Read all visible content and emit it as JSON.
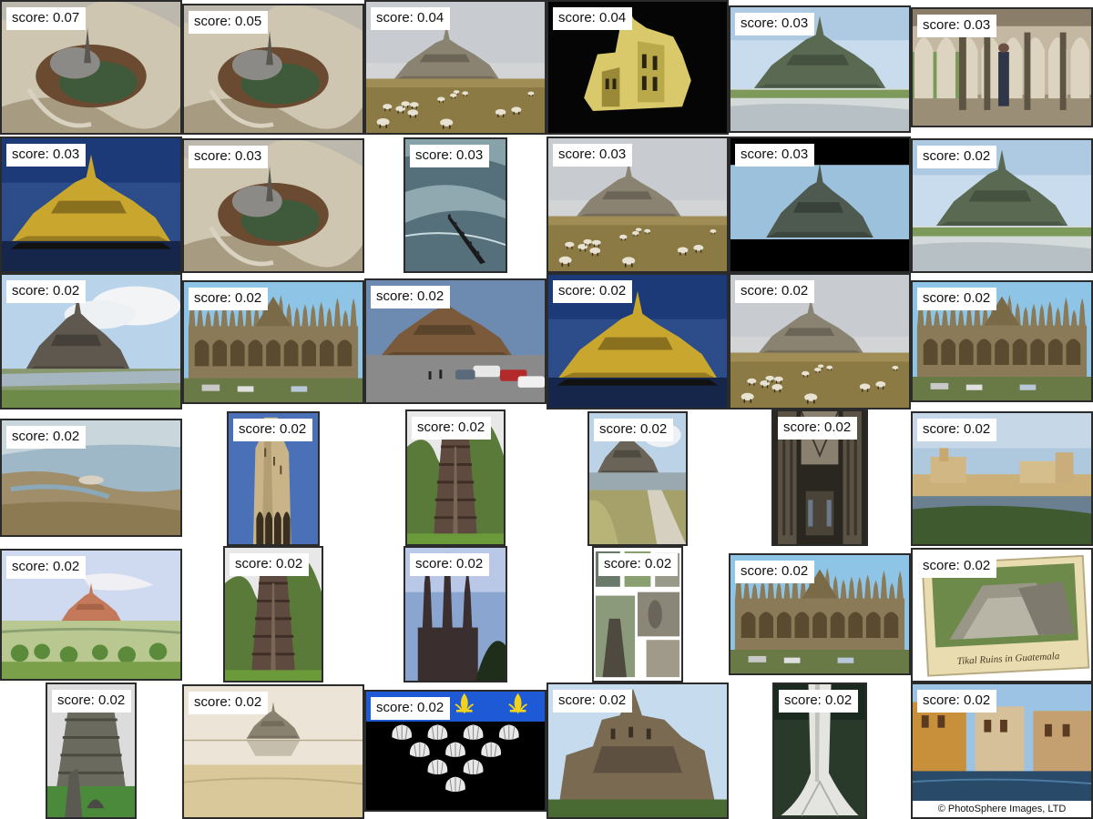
{
  "score_prefix": "score: ",
  "results": [
    {
      "score": "0.07",
      "scene": "aerial-island"
    },
    {
      "score": "0.05",
      "scene": "aerial-island"
    },
    {
      "score": "0.04",
      "scene": "abbey-meadow-sheep"
    },
    {
      "score": "0.04",
      "scene": "night-facade"
    },
    {
      "score": "0.03",
      "scene": "abbey-hill-day"
    },
    {
      "score": "0.03",
      "scene": "cloister-arches"
    },
    {
      "score": "0.03",
      "scene": "abbey-night-lit"
    },
    {
      "score": "0.03",
      "scene": "aerial-island"
    },
    {
      "score": "0.03",
      "scene": "tidal-flat"
    },
    {
      "score": "0.03",
      "scene": "abbey-meadow-sheep"
    },
    {
      "score": "0.03",
      "scene": "abbey-letterbox"
    },
    {
      "score": "0.02",
      "scene": "abbey-hill-day"
    },
    {
      "score": "0.02",
      "scene": "abbey-hill-cloudy"
    },
    {
      "score": "0.02",
      "scene": "gothic-cathedral"
    },
    {
      "score": "0.02",
      "scene": "abbey-carpark"
    },
    {
      "score": "0.02",
      "scene": "abbey-night-lit"
    },
    {
      "score": "0.02",
      "scene": "abbey-meadow-sheep"
    },
    {
      "score": "0.02",
      "scene": "gothic-cathedral"
    },
    {
      "score": "0.02",
      "scene": "aerial-bay"
    },
    {
      "score": "0.02",
      "scene": "stone-tower"
    },
    {
      "score": "0.02",
      "scene": "pyramid"
    },
    {
      "score": "0.02",
      "scene": "abbey-path"
    },
    {
      "score": "0.02",
      "scene": "cathedral-interior"
    },
    {
      "score": "0.02",
      "scene": "harbor-fort"
    },
    {
      "score": "0.02",
      "scene": "painting-abbey"
    },
    {
      "score": "0.02",
      "scene": "pyramid"
    },
    {
      "score": "0.02",
      "scene": "spire-silhouette"
    },
    {
      "score": "0.02",
      "scene": "collage"
    },
    {
      "score": "0.02",
      "scene": "gothic-cathedral"
    },
    {
      "score": "0.02",
      "scene": "postcard-ruins",
      "caption": "Tikal Ruins in Guatemala"
    },
    {
      "score": "0.02",
      "scene": "pyramid-statue"
    },
    {
      "score": "0.02",
      "scene": "sketch-abbey"
    },
    {
      "score": "0.02",
      "scene": "heraldic-shells"
    },
    {
      "score": "0.02",
      "scene": "abbey-closeup"
    },
    {
      "score": "0.02",
      "scene": "tree-trunk"
    },
    {
      "score": "0.02",
      "scene": "venice-canal",
      "credit": "© PhotoSphere Images, LTD"
    }
  ]
}
